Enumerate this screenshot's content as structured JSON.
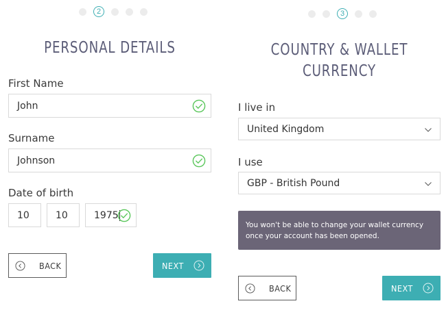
{
  "left": {
    "step": "2",
    "title": "PERSONAL DETAILS",
    "first_name_label": "First Name",
    "first_name_value": "John",
    "surname_label": "Surname",
    "surname_value": "Johnson",
    "dob_label": "Date of birth",
    "dob_day": "10",
    "dob_month": "10",
    "dob_year": "1975",
    "back_label": "BACK",
    "next_label": "NEXT"
  },
  "right": {
    "step": "3",
    "title_line1": "COUNTRY & WALLET",
    "title_line2": "CURRENCY",
    "live_label": "I live in",
    "country_value": "United Kingdom",
    "use_label": "I use",
    "currency_value": "GBP - British Pound",
    "notice_text": "You won't be able to change your wallet currency once your account has been opened.",
    "back_label": "BACK",
    "next_label": "NEXT"
  },
  "colors": {
    "accent": "#3daeb3",
    "title": "#5b5c77",
    "check": "#59c65a",
    "notice_bg": "#6b6577"
  }
}
